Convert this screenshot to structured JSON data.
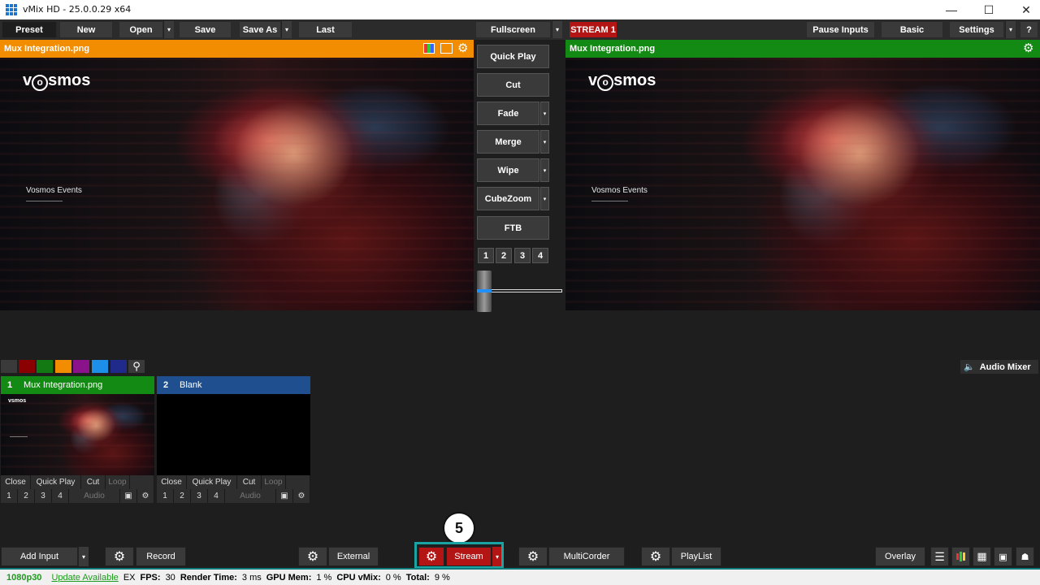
{
  "window": {
    "title": "vMix HD - 25.0.0.29 x64"
  },
  "topbar": {
    "preset": "Preset",
    "new": "New",
    "open": "Open",
    "save": "Save",
    "save_as": "Save As",
    "last": "Last",
    "fullscreen": "Fullscreen",
    "stream_tag": "STREAM 1",
    "pause_inputs": "Pause Inputs",
    "basic": "Basic",
    "settings": "Settings",
    "help": "?"
  },
  "preview": {
    "title": "Mux Integration.png",
    "header_color": "#f28c00"
  },
  "output": {
    "title": "Mux Integration.png",
    "header_color": "#138a13"
  },
  "slide": {
    "logo_a": "v",
    "logo_b": "smos",
    "events": "Vosmos Events"
  },
  "transitions": {
    "quick_play": "Quick Play",
    "cut": "Cut",
    "fade": "Fade",
    "merge": "Merge",
    "wipe": "Wipe",
    "cubezoom": "CubeZoom",
    "ftb": "FTB",
    "numbers": [
      "1",
      "2",
      "3",
      "4"
    ]
  },
  "color_swatches": [
    "#3a3a3a",
    "#8b0000",
    "#137a13",
    "#f28c00",
    "#8a128a",
    "#1e8fe8",
    "#1f2a8a"
  ],
  "audio_mixer": "Audio Mixer",
  "inputs": [
    {
      "number": "1",
      "name": "Mux Integration.png",
      "head_color": "#138a13",
      "close": "Close",
      "quick_play": "Quick Play",
      "cut": "Cut",
      "loop": "Loop",
      "nums": [
        "1",
        "2",
        "3",
        "4"
      ],
      "audio": "Audio"
    },
    {
      "number": "2",
      "name": "Blank",
      "head_color": "#1f4f8f",
      "close": "Close",
      "quick_play": "Quick Play",
      "cut": "Cut",
      "loop": "Loop",
      "nums": [
        "1",
        "2",
        "3",
        "4"
      ],
      "audio": "Audio"
    }
  ],
  "bottombar": {
    "add_input": "Add Input",
    "record": "Record",
    "external": "External",
    "stream": "Stream",
    "multicorder": "MultiCorder",
    "playlist": "PlayList",
    "overlay": "Overlay"
  },
  "callout": "5",
  "status": {
    "resolution": "1080p30",
    "update": "Update Available",
    "ex": "EX",
    "fps_label": "FPS:",
    "fps": "30",
    "render_label": "Render Time:",
    "render": "3 ms",
    "gpu_label": "GPU Mem:",
    "gpu": "1 %",
    "cpu_label": "CPU vMix:",
    "cpu": "0 %",
    "total_label": "Total:",
    "total": "9 %"
  }
}
